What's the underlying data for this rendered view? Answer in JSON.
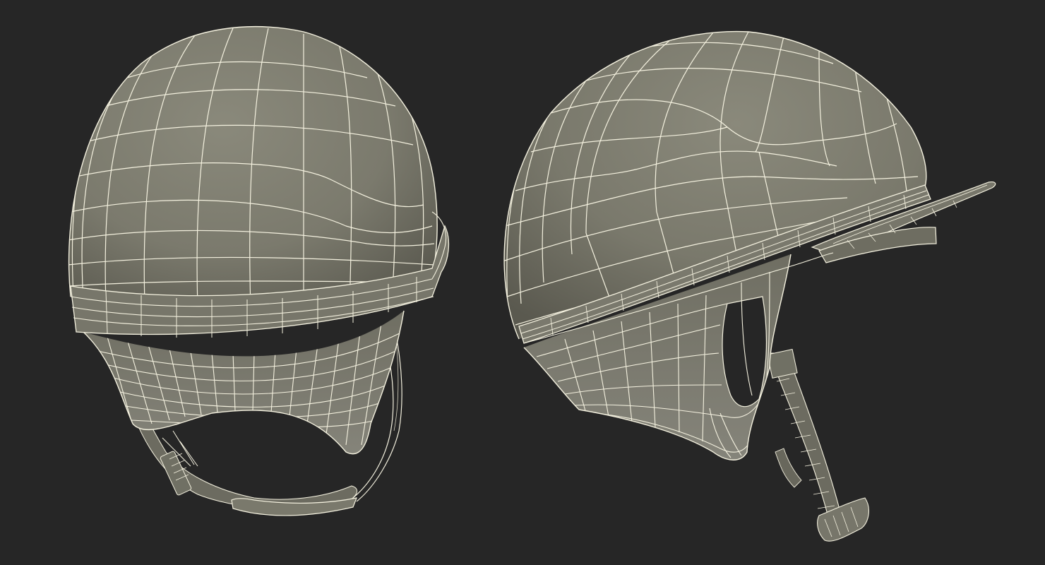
{
  "scene": {
    "background": "#262626",
    "shell_color": "#7c7b6e",
    "shell_shadow": "#5b5a50",
    "shell_highlight": "#9a998b",
    "wire_color": "#f4f1df",
    "models": [
      {
        "name": "helmet-front-three-quarter-view"
      },
      {
        "name": "helmet-side-view"
      }
    ]
  }
}
